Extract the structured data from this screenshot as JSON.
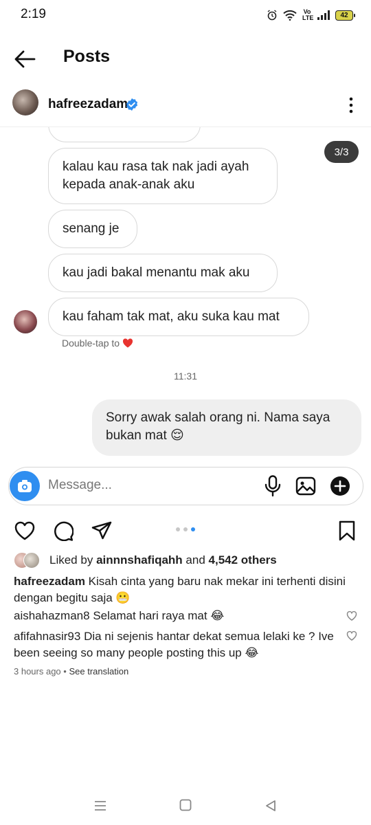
{
  "status_bar": {
    "time": "2:19",
    "volte_label": "Vo LTE",
    "battery": "42"
  },
  "header": {
    "title": "Posts"
  },
  "post": {
    "author": "hafreezadam",
    "image": {
      "page_counter": "3/3",
      "incoming_messages": [
        "kalau kau rasa tak nak jadi ayah kepada anak-anak aku",
        "senang je",
        "kau jadi bakal menantu mak aku",
        "kau faham tak mat, aku suka kau mat"
      ],
      "double_tap": "Double-tap to",
      "time_divider": "11:31",
      "outgoing_message": "Sorry awak salah orang ni. Nama saya bukan mat 😌",
      "composer_placeholder": "Message..."
    },
    "carousel": {
      "count": 3,
      "active": 3
    },
    "likes": {
      "prefix": "Liked by",
      "user": "ainnnshafiqahh",
      "joiner": "and",
      "others": "4,542 others"
    },
    "caption": {
      "author": "hafreezadam",
      "text": "Kisah cinta yang baru nak mekar ini terhenti disini dengan begitu saja 😬"
    },
    "comments": [
      {
        "user": "aishahazman8",
        "text": "Selamat hari raya mat 😂"
      },
      {
        "user": "afifahnasir93",
        "text": "Dia ni sejenis hantar dekat semua lelaki ke ? Ive been seeing so many people posting this up 😂"
      }
    ],
    "timestamp": "3 hours ago",
    "separator": "•",
    "see_translation": "See translation"
  },
  "colors": {
    "accent_blue": "#2f8ef0",
    "heart_red": "#e8332f"
  }
}
